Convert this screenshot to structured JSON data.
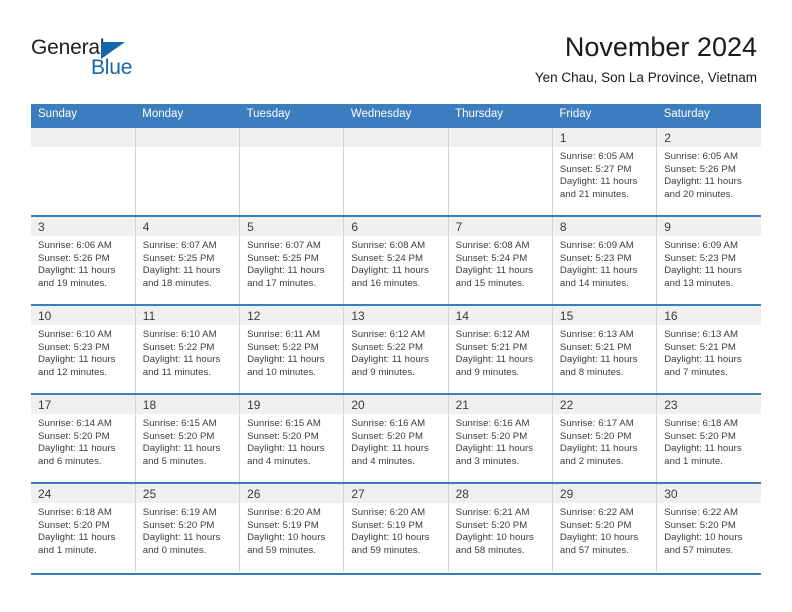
{
  "brand": {
    "name_part1": "General",
    "name_part2": "Blue",
    "accent_color": "#1567ab",
    "triangle_icon": "triangle-icon"
  },
  "header": {
    "title": "November 2024",
    "subtitle": "Yen Chau, Son La Province, Vietnam",
    "header_bg_color": "#3b7dbf",
    "daynum_band_color": "#f0f0f0"
  },
  "day_names": [
    "Sunday",
    "Monday",
    "Tuesday",
    "Wednesday",
    "Thursday",
    "Friday",
    "Saturday"
  ],
  "labels": {
    "sunrise_prefix": "Sunrise:",
    "sunset_prefix": "Sunset:",
    "daylight_prefix": "Daylight:"
  },
  "weeks": [
    [
      {
        "day": "",
        "empty": true
      },
      {
        "day": "",
        "empty": true
      },
      {
        "day": "",
        "empty": true
      },
      {
        "day": "",
        "empty": true
      },
      {
        "day": "",
        "empty": true
      },
      {
        "day": "1",
        "sunrise": "Sunrise: 6:05 AM",
        "sunset": "Sunset: 5:27 PM",
        "daylight1": "Daylight: 11 hours",
        "daylight2": "and 21 minutes."
      },
      {
        "day": "2",
        "sunrise": "Sunrise: 6:05 AM",
        "sunset": "Sunset: 5:26 PM",
        "daylight1": "Daylight: 11 hours",
        "daylight2": "and 20 minutes."
      }
    ],
    [
      {
        "day": "3",
        "sunrise": "Sunrise: 6:06 AM",
        "sunset": "Sunset: 5:26 PM",
        "daylight1": "Daylight: 11 hours",
        "daylight2": "and 19 minutes."
      },
      {
        "day": "4",
        "sunrise": "Sunrise: 6:07 AM",
        "sunset": "Sunset: 5:25 PM",
        "daylight1": "Daylight: 11 hours",
        "daylight2": "and 18 minutes."
      },
      {
        "day": "5",
        "sunrise": "Sunrise: 6:07 AM",
        "sunset": "Sunset: 5:25 PM",
        "daylight1": "Daylight: 11 hours",
        "daylight2": "and 17 minutes."
      },
      {
        "day": "6",
        "sunrise": "Sunrise: 6:08 AM",
        "sunset": "Sunset: 5:24 PM",
        "daylight1": "Daylight: 11 hours",
        "daylight2": "and 16 minutes."
      },
      {
        "day": "7",
        "sunrise": "Sunrise: 6:08 AM",
        "sunset": "Sunset: 5:24 PM",
        "daylight1": "Daylight: 11 hours",
        "daylight2": "and 15 minutes."
      },
      {
        "day": "8",
        "sunrise": "Sunrise: 6:09 AM",
        "sunset": "Sunset: 5:23 PM",
        "daylight1": "Daylight: 11 hours",
        "daylight2": "and 14 minutes."
      },
      {
        "day": "9",
        "sunrise": "Sunrise: 6:09 AM",
        "sunset": "Sunset: 5:23 PM",
        "daylight1": "Daylight: 11 hours",
        "daylight2": "and 13 minutes."
      }
    ],
    [
      {
        "day": "10",
        "sunrise": "Sunrise: 6:10 AM",
        "sunset": "Sunset: 5:23 PM",
        "daylight1": "Daylight: 11 hours",
        "daylight2": "and 12 minutes."
      },
      {
        "day": "11",
        "sunrise": "Sunrise: 6:10 AM",
        "sunset": "Sunset: 5:22 PM",
        "daylight1": "Daylight: 11 hours",
        "daylight2": "and 11 minutes."
      },
      {
        "day": "12",
        "sunrise": "Sunrise: 6:11 AM",
        "sunset": "Sunset: 5:22 PM",
        "daylight1": "Daylight: 11 hours",
        "daylight2": "and 10 minutes."
      },
      {
        "day": "13",
        "sunrise": "Sunrise: 6:12 AM",
        "sunset": "Sunset: 5:22 PM",
        "daylight1": "Daylight: 11 hours",
        "daylight2": "and 9 minutes."
      },
      {
        "day": "14",
        "sunrise": "Sunrise: 6:12 AM",
        "sunset": "Sunset: 5:21 PM",
        "daylight1": "Daylight: 11 hours",
        "daylight2": "and 9 minutes."
      },
      {
        "day": "15",
        "sunrise": "Sunrise: 6:13 AM",
        "sunset": "Sunset: 5:21 PM",
        "daylight1": "Daylight: 11 hours",
        "daylight2": "and 8 minutes."
      },
      {
        "day": "16",
        "sunrise": "Sunrise: 6:13 AM",
        "sunset": "Sunset: 5:21 PM",
        "daylight1": "Daylight: 11 hours",
        "daylight2": "and 7 minutes."
      }
    ],
    [
      {
        "day": "17",
        "sunrise": "Sunrise: 6:14 AM",
        "sunset": "Sunset: 5:20 PM",
        "daylight1": "Daylight: 11 hours",
        "daylight2": "and 6 minutes."
      },
      {
        "day": "18",
        "sunrise": "Sunrise: 6:15 AM",
        "sunset": "Sunset: 5:20 PM",
        "daylight1": "Daylight: 11 hours",
        "daylight2": "and 5 minutes."
      },
      {
        "day": "19",
        "sunrise": "Sunrise: 6:15 AM",
        "sunset": "Sunset: 5:20 PM",
        "daylight1": "Daylight: 11 hours",
        "daylight2": "and 4 minutes."
      },
      {
        "day": "20",
        "sunrise": "Sunrise: 6:16 AM",
        "sunset": "Sunset: 5:20 PM",
        "daylight1": "Daylight: 11 hours",
        "daylight2": "and 4 minutes."
      },
      {
        "day": "21",
        "sunrise": "Sunrise: 6:16 AM",
        "sunset": "Sunset: 5:20 PM",
        "daylight1": "Daylight: 11 hours",
        "daylight2": "and 3 minutes."
      },
      {
        "day": "22",
        "sunrise": "Sunrise: 6:17 AM",
        "sunset": "Sunset: 5:20 PM",
        "daylight1": "Daylight: 11 hours",
        "daylight2": "and 2 minutes."
      },
      {
        "day": "23",
        "sunrise": "Sunrise: 6:18 AM",
        "sunset": "Sunset: 5:20 PM",
        "daylight1": "Daylight: 11 hours",
        "daylight2": "and 1 minute."
      }
    ],
    [
      {
        "day": "24",
        "sunrise": "Sunrise: 6:18 AM",
        "sunset": "Sunset: 5:20 PM",
        "daylight1": "Daylight: 11 hours",
        "daylight2": "and 1 minute."
      },
      {
        "day": "25",
        "sunrise": "Sunrise: 6:19 AM",
        "sunset": "Sunset: 5:20 PM",
        "daylight1": "Daylight: 11 hours",
        "daylight2": "and 0 minutes."
      },
      {
        "day": "26",
        "sunrise": "Sunrise: 6:20 AM",
        "sunset": "Sunset: 5:19 PM",
        "daylight1": "Daylight: 10 hours",
        "daylight2": "and 59 minutes."
      },
      {
        "day": "27",
        "sunrise": "Sunrise: 6:20 AM",
        "sunset": "Sunset: 5:19 PM",
        "daylight1": "Daylight: 10 hours",
        "daylight2": "and 59 minutes."
      },
      {
        "day": "28",
        "sunrise": "Sunrise: 6:21 AM",
        "sunset": "Sunset: 5:20 PM",
        "daylight1": "Daylight: 10 hours",
        "daylight2": "and 58 minutes."
      },
      {
        "day": "29",
        "sunrise": "Sunrise: 6:22 AM",
        "sunset": "Sunset: 5:20 PM",
        "daylight1": "Daylight: 10 hours",
        "daylight2": "and 57 minutes."
      },
      {
        "day": "30",
        "sunrise": "Sunrise: 6:22 AM",
        "sunset": "Sunset: 5:20 PM",
        "daylight1": "Daylight: 10 hours",
        "daylight2": "and 57 minutes."
      }
    ]
  ]
}
